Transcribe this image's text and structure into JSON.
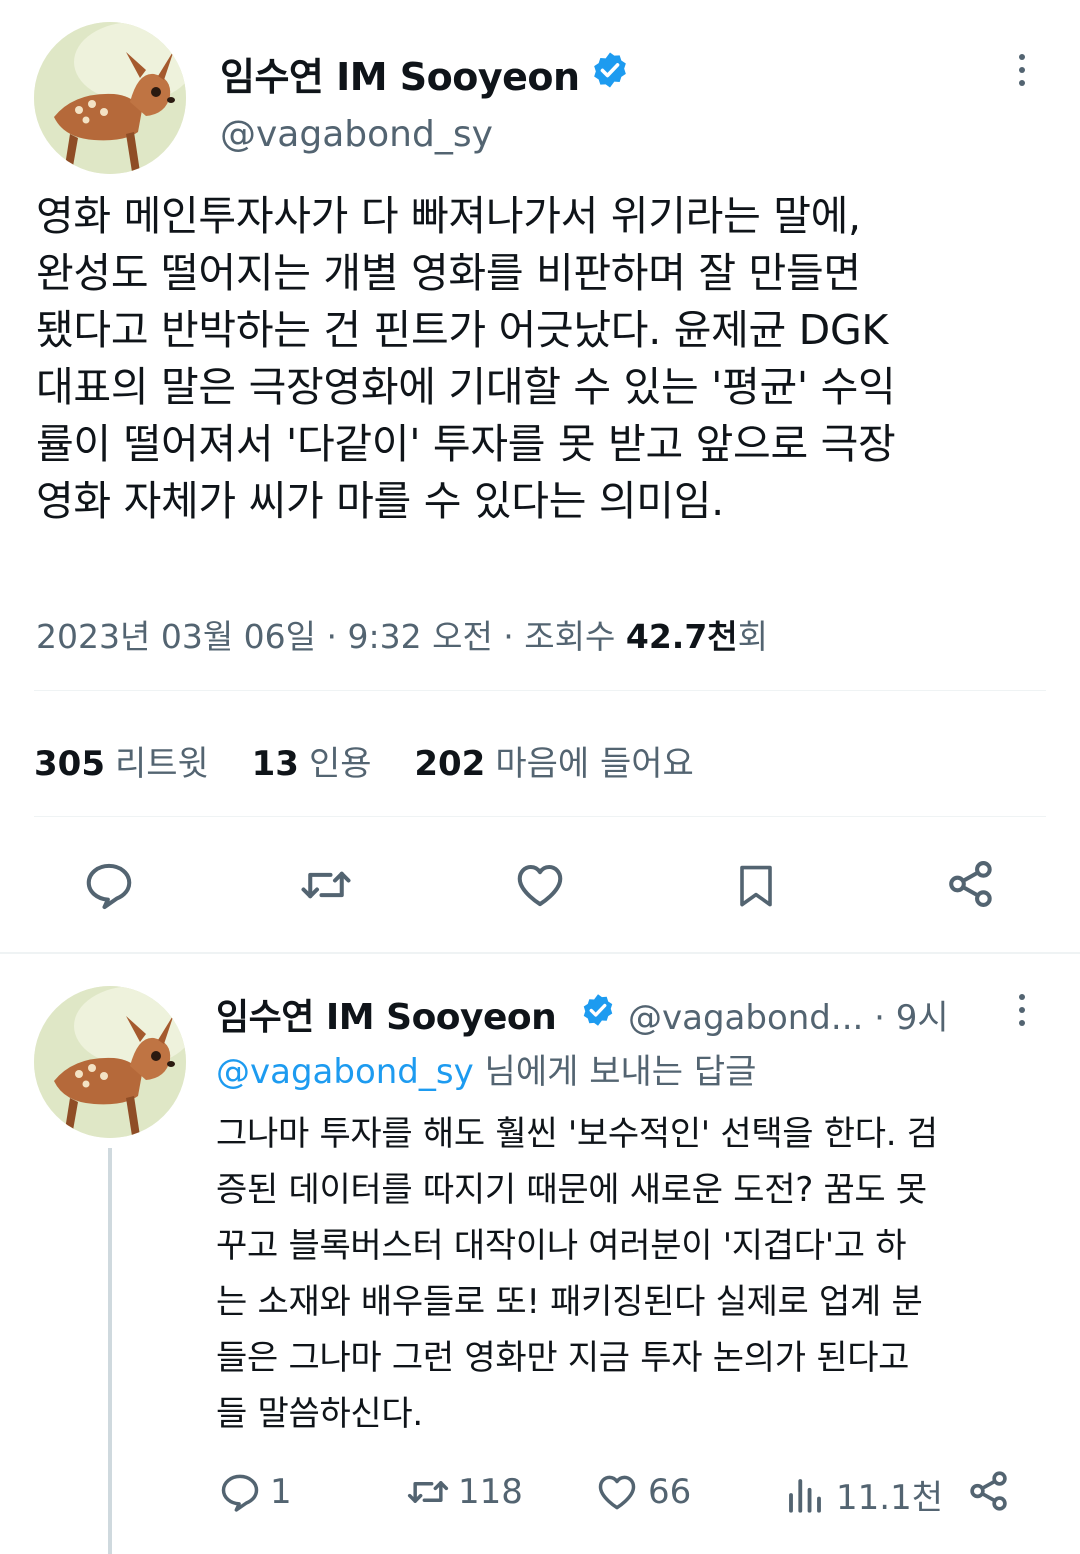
{
  "main_tweet": {
    "author_name": "임수연 IM Sooyeon",
    "handle": "@vagabond_sy",
    "avatar": "fawn-avatar",
    "verified_icon": "verified-badge-icon",
    "text": "영화 메인투자사가 다 빠져나가서 위기라는 말에,\n완성도 떨어지는 개별 영화를 비판하며 잘 만들면\n됐다고 반박하는 건 핀트가 어긋났다. 윤제균 DGK\n대표의 말은 극장영화에 기대할 수 있는 '평균' 수익\n률이 떨어져서 '다같이' 투자를 못 받고 앞으로 극장\n영화 자체가 씨가 마를 수 있다는 의미임.",
    "date": "2023년 03월 06일 · 9:32 오전 · 조회수",
    "views_value": "42.7천",
    "views_unit": "회",
    "stats": {
      "retweets_count": "305",
      "retweets_label": "리트윗",
      "quotes_count": "13",
      "quotes_label": "인용",
      "likes_count": "202",
      "likes_label": "마음에 들어요"
    },
    "actions": [
      "reply-icon",
      "retweet-icon",
      "like-icon",
      "bookmark-icon",
      "share-icon"
    ]
  },
  "reply_tweet": {
    "author_name": "임수연 IM Sooyeon",
    "handle_time": "@vagabond... · 9시",
    "reply_to_handle": "@vagabond_sy",
    "reply_to_suffix": " 님에게 보내는 답글",
    "text": "그나마 투자를 해도 훨씬 '보수적인' 선택을 한다. 검\n증된 데이터를 따지기 때문에 새로운 도전? 꿈도 못\n꾸고 블록버스터 대작이나 여러분이 '지겹다'고 하\n는 소재와 배우들로 또! 패키징된다 실제로 업계 분\n들은 그나마 그런 영화만 지금 투자 논의가 된다고\n들 말씀하신다.",
    "actions": {
      "replies": "1",
      "retweets": "118",
      "likes": "66",
      "views": "11.1천"
    }
  },
  "colors": {
    "accent": "#1d9bf0",
    "secondary_text": "#536471",
    "primary_text": "#0f1419"
  }
}
